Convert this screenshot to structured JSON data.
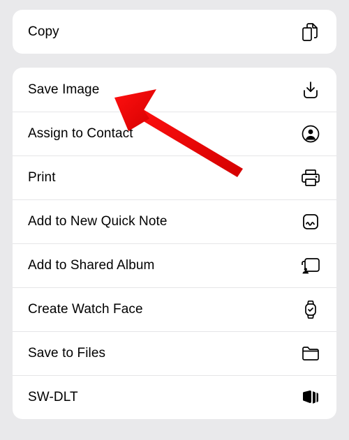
{
  "copy": {
    "label": "Copy"
  },
  "actions": [
    {
      "id": "save-image",
      "label": "Save Image",
      "icon": "download-tray-icon"
    },
    {
      "id": "assign-contact",
      "label": "Assign to Contact",
      "icon": "contact-circle-icon"
    },
    {
      "id": "print",
      "label": "Print",
      "icon": "printer-icon"
    },
    {
      "id": "quick-note",
      "label": "Add to New Quick Note",
      "icon": "quick-note-icon"
    },
    {
      "id": "shared-album",
      "label": "Add to Shared Album",
      "icon": "shared-album-icon"
    },
    {
      "id": "watch-face",
      "label": "Create Watch Face",
      "icon": "watch-icon"
    },
    {
      "id": "save-files",
      "label": "Save to Files",
      "icon": "folder-icon"
    },
    {
      "id": "sw-dlt",
      "label": "SW-DLT",
      "icon": "stack-icon"
    }
  ],
  "annotation": {
    "type": "arrow",
    "points_to": "save-image",
    "color": "#ff0000"
  }
}
